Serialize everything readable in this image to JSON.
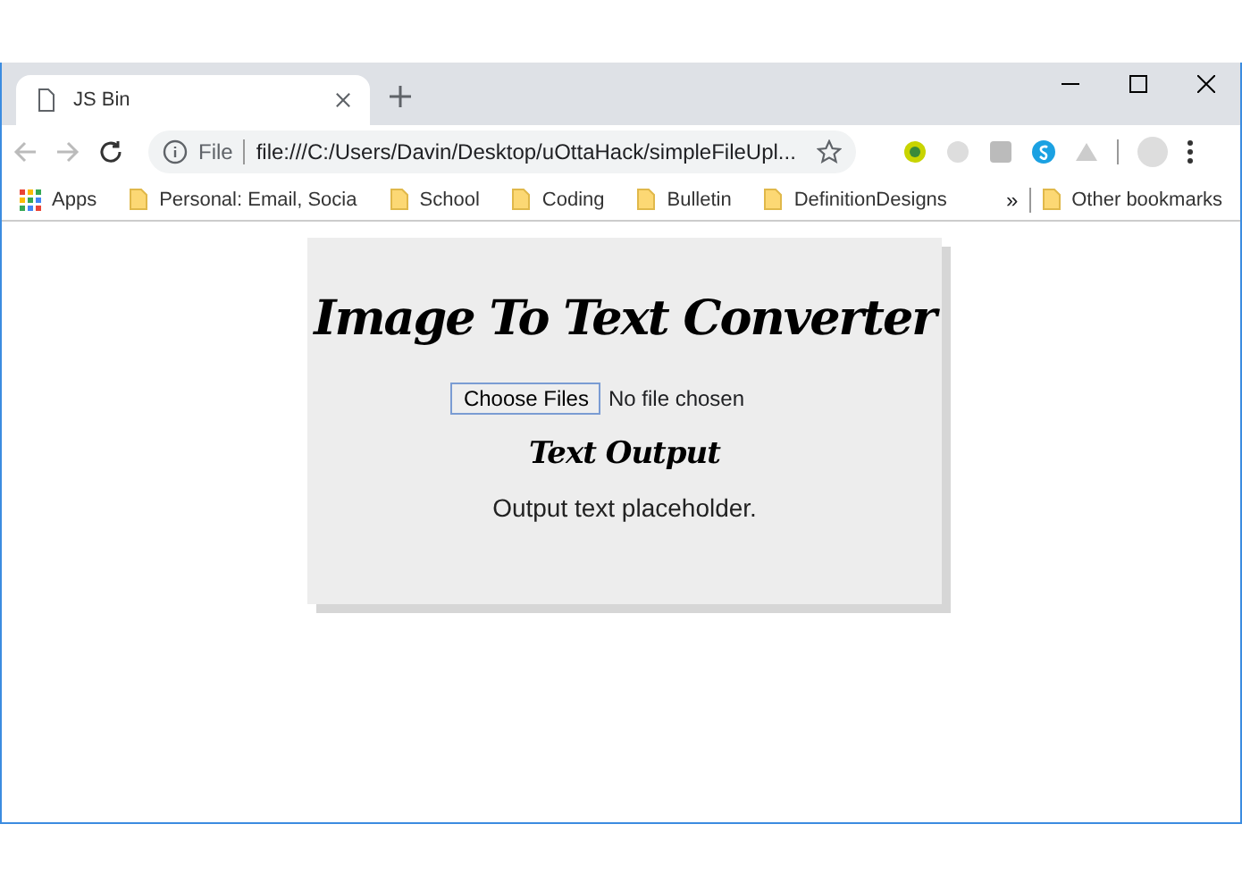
{
  "tabs": [
    {
      "title": "JS Bin",
      "selected": true
    }
  ],
  "address": {
    "scheme_label": "File",
    "url": "file:///C:/Users/Davin/Desktop/uOttaHack/simpleFileUpl..."
  },
  "bookmarks": [
    {
      "kind": "apps",
      "label": "Apps"
    },
    {
      "kind": "folder",
      "label": "Personal: Email, Socia"
    },
    {
      "kind": "folder",
      "label": "School"
    },
    {
      "kind": "folder",
      "label": "Coding"
    },
    {
      "kind": "folder",
      "label": "Bulletin"
    },
    {
      "kind": "folder",
      "label": "DefinitionDesigns"
    }
  ],
  "bookmarks_overflow": "»",
  "other_bookmarks": "Other bookmarks",
  "page": {
    "title": "Image To Text Converter",
    "file_button": "Choose Files",
    "file_status": "No file chosen",
    "output_heading": "Text Output",
    "output_text": "Output text placeholder."
  }
}
